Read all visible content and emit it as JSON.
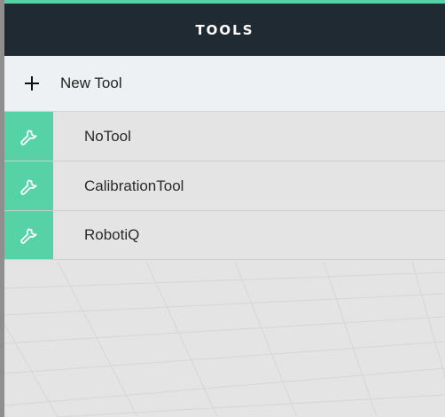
{
  "header": {
    "title": "TOOLS"
  },
  "new_tool": {
    "label": "New Tool",
    "icon": "plus-icon"
  },
  "tools": [
    {
      "name": "NoTool",
      "icon": "wrench-icon"
    },
    {
      "name": "CalibrationTool",
      "icon": "wrench-icon"
    },
    {
      "name": "RobotiQ",
      "icon": "wrench-icon"
    }
  ],
  "colors": {
    "accent": "#56d3a6",
    "header_bg": "#1f2a33",
    "new_tool_bg": "#eef1f4",
    "list_bg": "#e4e4e4"
  }
}
